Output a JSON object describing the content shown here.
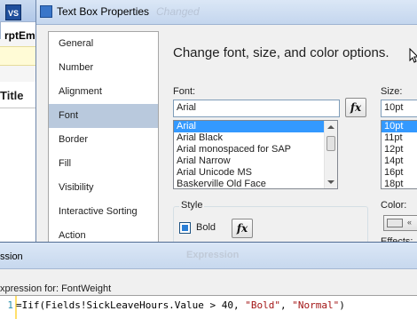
{
  "background": {
    "app_abbrev": "rptEm",
    "tab_title": "rptEm",
    "column_header": "Title"
  },
  "dialog": {
    "title": "Text Box Properties",
    "title_ghost": "Changed",
    "nav_items": [
      "General",
      "Number",
      "Alignment",
      "Font",
      "Border",
      "Fill",
      "Visibility",
      "Interactive Sorting",
      "Action"
    ],
    "selected_nav": "Font",
    "heading": "Change font, size, and color options.",
    "font_label": "Font:",
    "font_value": "Arial",
    "fonts": [
      "Arial",
      "Arial Black",
      "Arial monospaced for SAP",
      "Arial Narrow",
      "Arial Unicode MS",
      "Baskerville Old Face"
    ],
    "size_label": "Size:",
    "size_value": "10pt",
    "sizes": [
      "10pt",
      "11pt",
      "12pt",
      "14pt",
      "16pt",
      "18pt"
    ],
    "style_label": "Style",
    "bold_label": "Bold",
    "color_label": "Color:",
    "color_value": "«",
    "effects_label": "Effects:",
    "fx_label": "fx"
  },
  "expression_dialog": {
    "title": "ssion",
    "title_ghost": "Expression",
    "subtitle": "xpression for: FontWeight",
    "line_number": "1",
    "code_prefix": "=Iif(Fields!SickLeaveHours.Value > 40, ",
    "code_str1": "\"Bold\"",
    "code_sep": ", ",
    "code_str2": "\"Normal\"",
    "code_suffix": ")"
  },
  "colors": {
    "selection": "#3399ff",
    "nav_selection": "#b9c9dd",
    "string_literal": "#a31515",
    "line_number": "#2b91af"
  }
}
